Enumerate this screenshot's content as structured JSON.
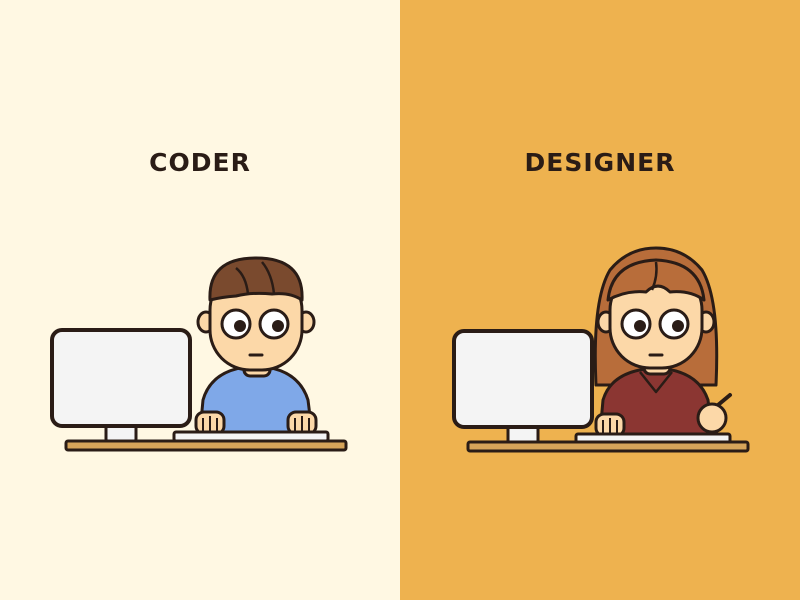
{
  "panels": {
    "left": {
      "title": "CODER",
      "background": "#FFF8E3"
    },
    "right": {
      "title": "DESIGNER",
      "background": "#EEB24F"
    }
  },
  "colors": {
    "outline": "#2A1C16",
    "skin": "#FCD8A8",
    "coder_hair": "#7A4A2E",
    "coder_shirt": "#7FA8E8",
    "designer_hair": "#B86D3A",
    "designer_shirt": "#8B3632",
    "monitor": "#F4F4F4",
    "desk": "#D6A45A"
  },
  "icons": [
    "monitor-icon",
    "keyboard-icon",
    "desk-icon",
    "person-icon",
    "drawing-pen-icon"
  ]
}
